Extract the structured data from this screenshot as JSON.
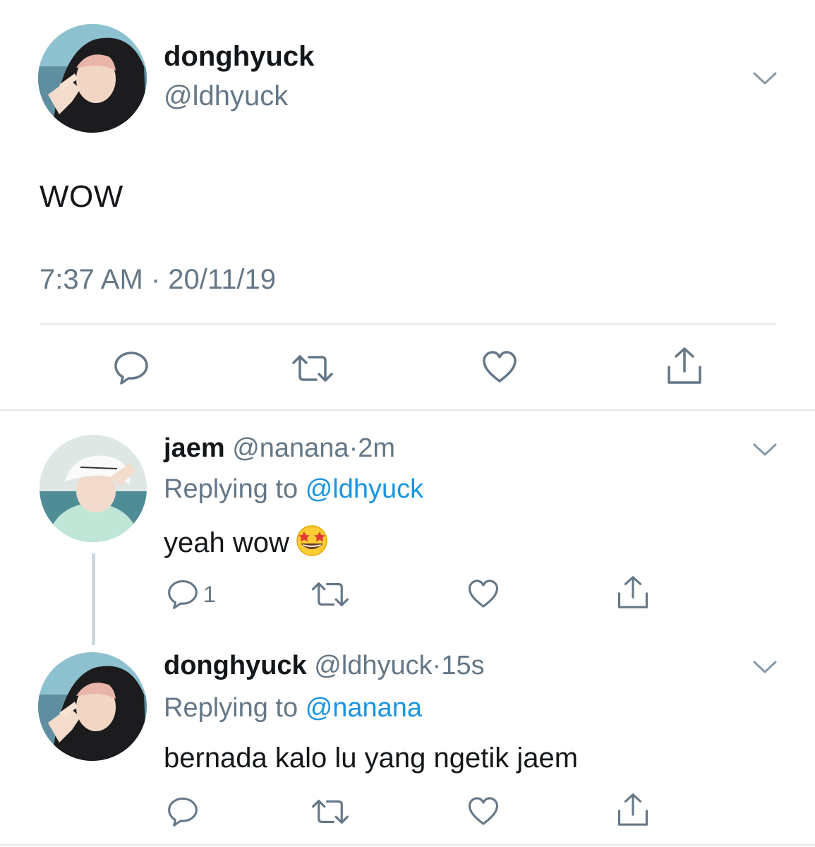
{
  "main_tweet": {
    "avatar": "donghyuck-avatar-photo",
    "display_name": "donghyuck",
    "handle": "@ldhyuck",
    "text": "WOW",
    "meta": "7:37 AM · 20/11/19",
    "menu_icon": "chevron-down-icon",
    "actions": {
      "reply_icon": "reply-icon",
      "retweet_icon": "retweet-icon",
      "like_icon": "heart-icon",
      "share_icon": "share-icon"
    }
  },
  "replies": [
    {
      "avatar": "jaem-avatar-photo",
      "display_name": "jaem",
      "handle": "@nanana",
      "separator": "·",
      "time": "2m",
      "replying_prefix": "Replying to",
      "replying_to": "@ldhyuck",
      "text": "yeah wow",
      "emoji": "star-struck-emoji",
      "reply_count": "1"
    },
    {
      "avatar": "donghyuck-avatar-photo",
      "display_name": "donghyuck",
      "handle": "@ldhyuck",
      "separator": "·",
      "time": "15s",
      "replying_prefix": "Replying to",
      "replying_to": "@nanana",
      "text": "bernada kalo lu yang ngetik jaem",
      "reply_count": ""
    }
  ],
  "colors": {
    "text_primary": "#14171a",
    "text_secondary": "#657786",
    "link": "#1b95e0",
    "divider": "#e1e8ed",
    "icon": "#657786"
  }
}
